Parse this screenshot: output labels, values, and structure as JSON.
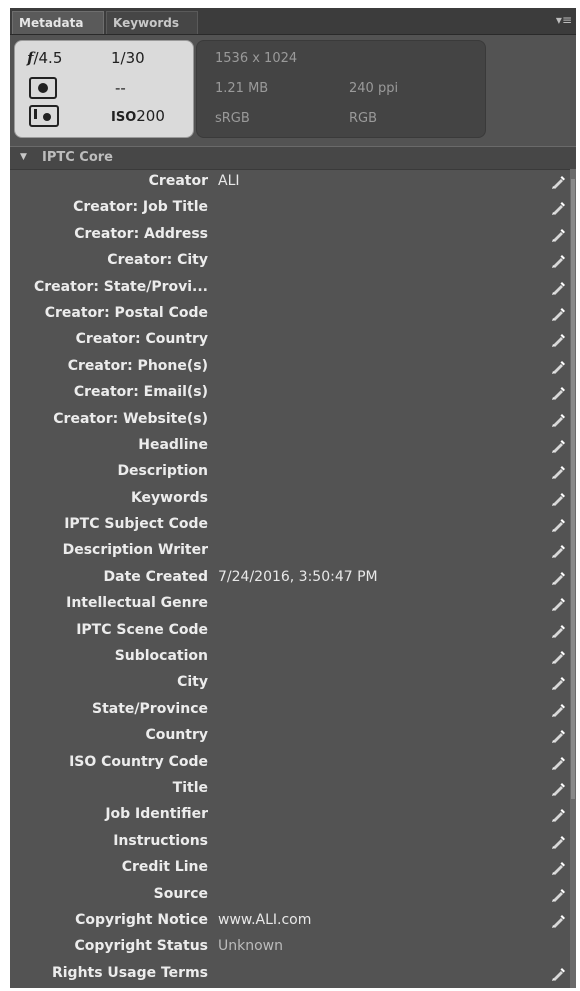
{
  "tabs": [
    "Metadata",
    "Keywords"
  ],
  "camera": {
    "aperture": "4.5",
    "shutter": "1/30",
    "metering": "--",
    "iso": "200"
  },
  "file": {
    "dimensions": "1536 x 1024",
    "size": "1.21 MB",
    "resolution": "240 ppi",
    "color_profile": "sRGB",
    "color_mode": "RGB"
  },
  "section": {
    "title": "IPTC Core"
  },
  "fields": [
    {
      "label": "Creator",
      "value": "ALI"
    },
    {
      "label": "Creator: Job Title",
      "value": ""
    },
    {
      "label": "Creator: Address",
      "value": ""
    },
    {
      "label": "Creator: City",
      "value": ""
    },
    {
      "label": "Creator: State/Provi...",
      "value": ""
    },
    {
      "label": "Creator: Postal Code",
      "value": ""
    },
    {
      "label": "Creator: Country",
      "value": ""
    },
    {
      "label": "Creator: Phone(s)",
      "value": ""
    },
    {
      "label": "Creator: Email(s)",
      "value": ""
    },
    {
      "label": "Creator: Website(s)",
      "value": ""
    },
    {
      "label": "Headline",
      "value": ""
    },
    {
      "label": "Description",
      "value": ""
    },
    {
      "label": "Keywords",
      "value": ""
    },
    {
      "label": "IPTC Subject Code",
      "value": ""
    },
    {
      "label": "Description Writer",
      "value": ""
    },
    {
      "label": "Date Created",
      "value": "7/24/2016, 3:50:47 PM"
    },
    {
      "label": "Intellectual Genre",
      "value": ""
    },
    {
      "label": "IPTC Scene Code",
      "value": ""
    },
    {
      "label": "Sublocation",
      "value": ""
    },
    {
      "label": "City",
      "value": ""
    },
    {
      "label": "State/Province",
      "value": ""
    },
    {
      "label": "Country",
      "value": ""
    },
    {
      "label": "ISO Country Code",
      "value": ""
    },
    {
      "label": "Title",
      "value": ""
    },
    {
      "label": "Job Identifier",
      "value": ""
    },
    {
      "label": "Instructions",
      "value": ""
    },
    {
      "label": "Credit Line",
      "value": ""
    },
    {
      "label": "Source",
      "value": ""
    },
    {
      "label": "Copyright Notice",
      "value": "www.ALI.com"
    },
    {
      "label": "Copyright Status",
      "value": "Unknown"
    },
    {
      "label": "Rights Usage Terms",
      "value": ""
    }
  ]
}
